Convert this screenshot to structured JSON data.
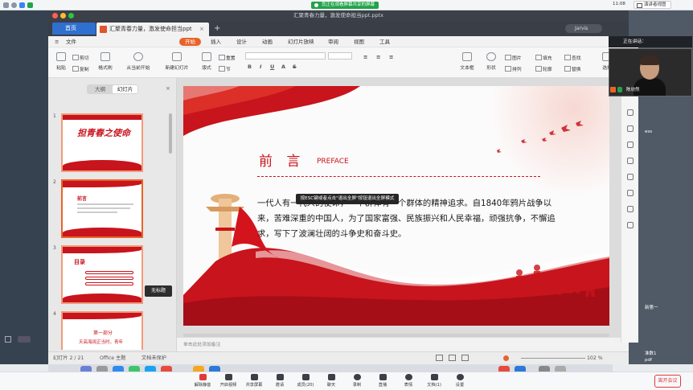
{
  "screen_share_banner": "您正在观看屏幕共享的屏幕",
  "clock": "11:08",
  "view_button": "演讲者视图",
  "window_title": "汇聚青春力量，激发使命担当ppt.pptx",
  "tabs": {
    "home": "首页",
    "doc": "汇聚青春力量，激发使命担当ppt"
  },
  "user_name": "Jarvis",
  "menu": {
    "file": "文件",
    "start": "开始",
    "insert": "插入",
    "design": "设计",
    "animation": "动画",
    "slideshow": "幻灯片放映",
    "review": "审阅",
    "view": "视图",
    "tools": "工具"
  },
  "ribbon": {
    "paste": "粘贴",
    "cut": "剪切",
    "copy": "复制",
    "format_painter": "格式刷",
    "from_current": "从当前开始",
    "new_slide": "新建幻灯片",
    "layout": "版式",
    "section": "节",
    "reset": "重置",
    "textbox": "文本框",
    "shape": "形状",
    "arrange": "排列",
    "picture": "图片",
    "fill": "填充",
    "outline": "轮廓",
    "find": "查找",
    "replace": "替换",
    "select": "选择"
  },
  "panel": {
    "outline_tab": "大纲",
    "slides_tab": "幻灯片",
    "tooltip": "无标题",
    "add": "+"
  },
  "thumbnails": [
    {
      "num": "1",
      "title": "担青春之使命"
    },
    {
      "num": "2",
      "title": "前言"
    },
    {
      "num": "3",
      "title": "目录"
    },
    {
      "num": "4",
      "part": "第一部分",
      "title": "天高海阔正当时，青年"
    }
  ],
  "slide": {
    "heading": "前 言",
    "heading_en": "PREFACE",
    "body": "一代人有一代人的使命，一个群体有一个群体的精神追求。自1840年鸦片战争以来，苦难深重的中国人，为了国家富强、民族振兴和人民幸福，顽强抗争，不懈追求，写下了波澜壮阔的斗争史和奋斗史。",
    "esc_tip": "按ESC键或者点击\"退出全屏\"按钮退出全屏模式"
  },
  "notes_placeholder": "单击此处添加备注",
  "status": {
    "slide_pos": "幻灯片 2 / 21",
    "theme": "Office 主题",
    "protect": "文档未保护",
    "zoom": "102 %"
  },
  "video": {
    "header": "正在讲话：",
    "name": "陈欣然"
  },
  "desktop_right": [
    "ess",
    "新第一",
    "准数1",
    "pdf"
  ],
  "meeting_bar": [
    {
      "label": "解除静音",
      "icon": "mic-icon"
    },
    {
      "label": "开启视频",
      "icon": "camera-icon"
    },
    {
      "label": "共享屏幕",
      "icon": "share-icon"
    },
    {
      "label": "邀请",
      "icon": "invite-icon"
    },
    {
      "label": "成员(20)",
      "icon": "members-icon"
    },
    {
      "label": "聊天",
      "icon": "chat-icon"
    },
    {
      "label": "录制",
      "icon": "record-icon"
    },
    {
      "label": "直播",
      "icon": "live-icon"
    },
    {
      "label": "表情",
      "icon": "emoji-icon"
    },
    {
      "label": "文档(1)",
      "icon": "doc-icon"
    },
    {
      "label": "设置",
      "icon": "settings-icon"
    }
  ],
  "leave_button": "离开会议",
  "colors": {
    "accent": "#e8632a",
    "slide_red": "#c8141c",
    "banner": "#22a34a"
  }
}
